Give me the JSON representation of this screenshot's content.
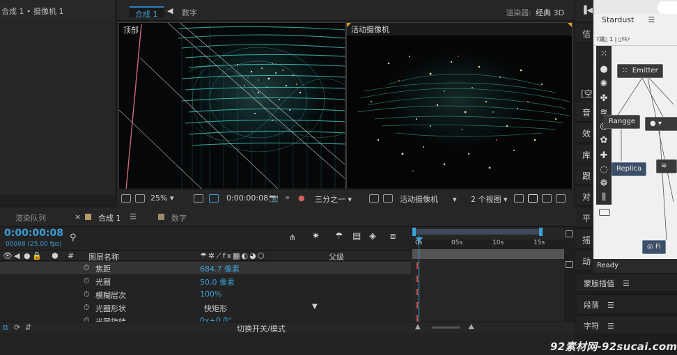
{
  "project_panel": {
    "title": "合成 1 • 摄像机 1"
  },
  "viewer": {
    "tabs": [
      {
        "label": "合成 1"
      },
      {
        "label": "数字"
      }
    ],
    "renderer_label": "渲染器:",
    "renderer_value": "经典 3D",
    "left_view_label": "顶部",
    "right_view_label": "活动摄像机",
    "toolbar": {
      "zoom": "25%",
      "timecode": "0:00:00:08",
      "resolution": "三分之一",
      "camera": "活动摄像机",
      "views": "2 个视图"
    }
  },
  "side_column": {
    "items": [
      "信",
      "[空",
      "音",
      "效",
      "库",
      "跟",
      "对",
      "平",
      "摇",
      "动"
    ]
  },
  "stardust": {
    "title": "Stardust",
    "toolbar_text": "ﾏ滅▯ 1  |  ▯ﾘﾓｧ",
    "status": "Ready",
    "nodes": [
      {
        "label": "Emitter"
      },
      {
        "label": "Rangge"
      },
      {
        "label": "Replica"
      },
      {
        "label": "Fi"
      }
    ]
  },
  "right_panels": [
    {
      "label": "蒙版插值"
    },
    {
      "label": "段落"
    },
    {
      "label": "字符"
    }
  ],
  "timeline": {
    "tabs": [
      {
        "label": "渲染队列"
      },
      {
        "label": "合成 1"
      },
      {
        "label": "数字"
      }
    ],
    "timecode": "0:00:00:08",
    "frames": "00008 (25.00 fps)",
    "col_hash": "#",
    "col_layer_name": "图层名称",
    "col_parent": "父级",
    "rows": [
      {
        "name": "焦距",
        "value": "684.7 像素"
      },
      {
        "name": "光圈",
        "value": "50.0 像素"
      },
      {
        "name": "模糊层次",
        "value": "100%"
      },
      {
        "name": "光圈形状",
        "value": "快矩形"
      },
      {
        "name": "光圈旋转",
        "value": "0x+0.0°"
      }
    ],
    "footer_label": "切换开关/模式",
    "ruler_ticks": [
      "0s",
      "05s",
      "10s",
      "15s"
    ]
  },
  "watermark": "92素材网-92sucai.com",
  "colors": {
    "accent": "#3d9fd6",
    "background": "#232323",
    "keyframe": "#c85050"
  }
}
